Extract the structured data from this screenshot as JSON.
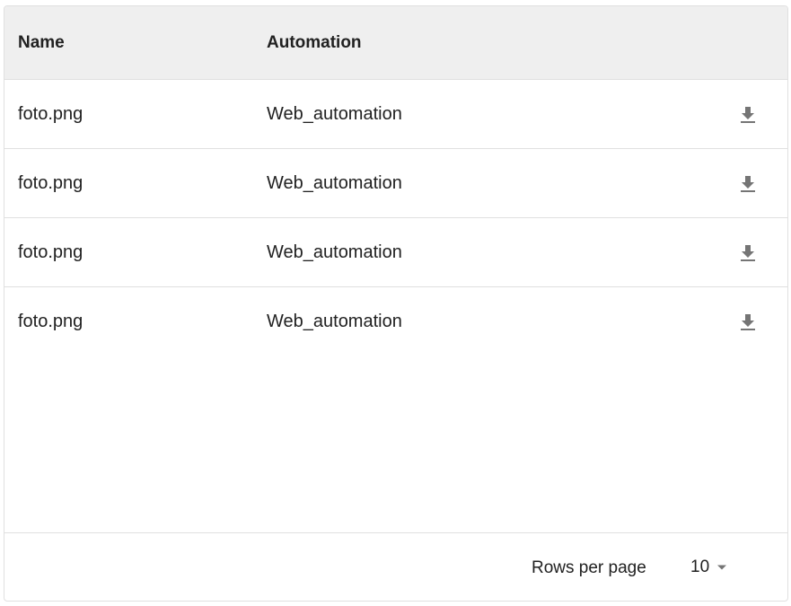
{
  "table": {
    "headers": {
      "name": "Name",
      "automation": "Automation"
    },
    "rows": [
      {
        "name": "foto.png",
        "automation": "Web_automation",
        "action_icon": "download-icon"
      },
      {
        "name": "foto.png",
        "automation": "Web_automation",
        "action_icon": "download-icon"
      },
      {
        "name": "foto.png",
        "automation": "Web_automation",
        "action_icon": "download-icon"
      },
      {
        "name": "foto.png",
        "automation": "Web_automation",
        "action_icon": "download-icon"
      }
    ]
  },
  "pagination": {
    "rows_per_page_label": "Rows per page",
    "rows_per_page_value": "10",
    "dropdown_icon": "caret-down-icon"
  },
  "colors": {
    "header_bg": "#efefef",
    "border": "#e0e0e0",
    "text": "#212121",
    "icon": "#757575"
  }
}
